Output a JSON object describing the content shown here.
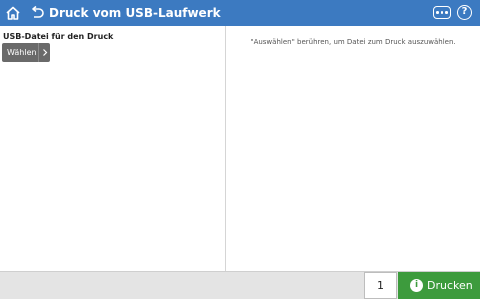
{
  "header": {
    "title": "Druck vom USB-Laufwerk",
    "home_icon": "home-icon",
    "back_icon": "back-icon",
    "more_icon": "more-options-icon",
    "help_icon": "help-icon",
    "help_glyph": "?",
    "color": "#3c7ac1"
  },
  "left_panel": {
    "section_label": "USB-Datei für den Druck",
    "choose_button": "Wählen",
    "choose_icon": "chevron-right-icon"
  },
  "right_panel": {
    "instruction": "\"Auswählen\" berühren, um Datei zum Druck auszuwählen."
  },
  "footer": {
    "copies_value": "1",
    "print_button": "Drucken",
    "print_icon": "info-icon",
    "print_icon_glyph": "i",
    "print_color": "#3d9b3d"
  }
}
